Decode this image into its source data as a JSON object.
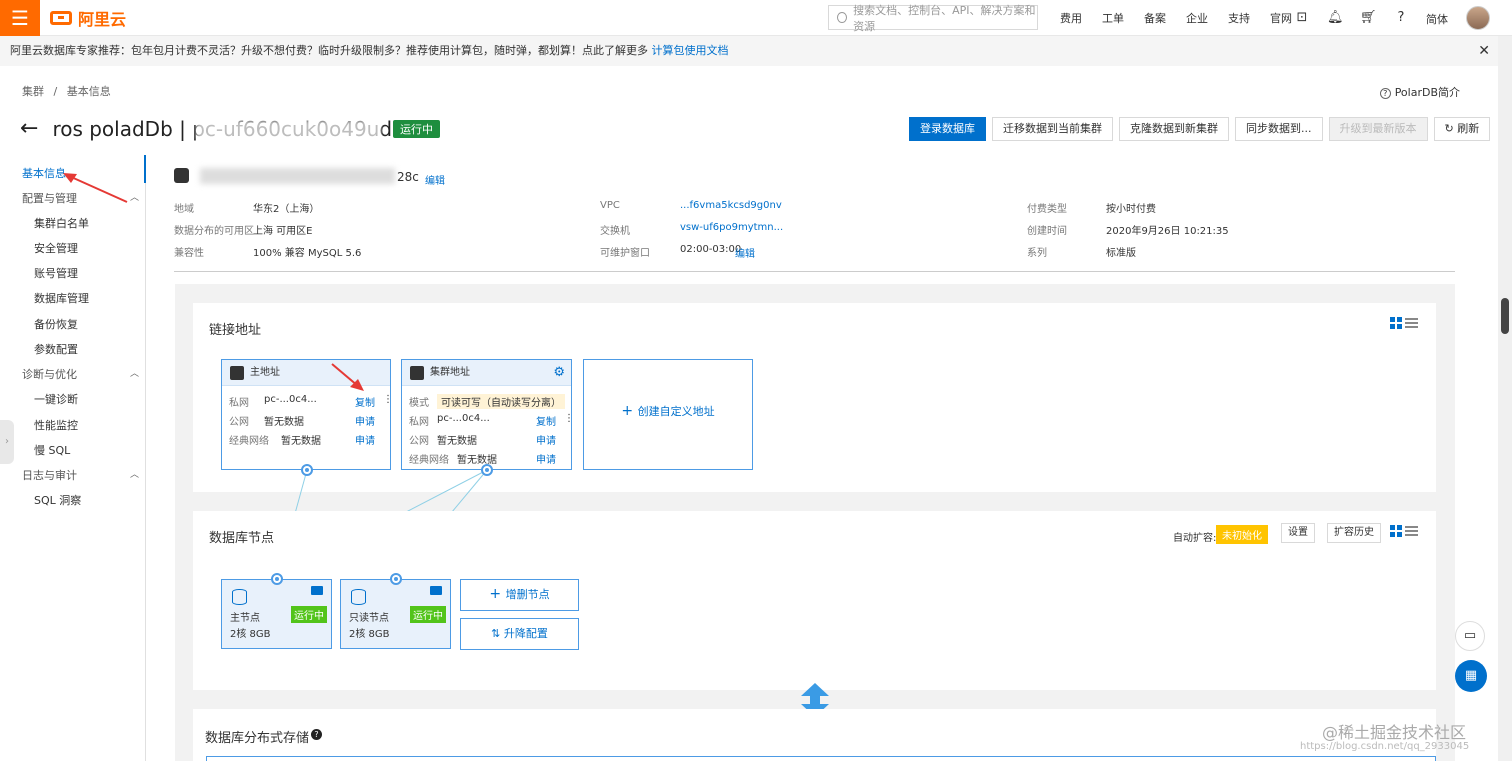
{
  "topbar": {
    "logo_text": "阿里云",
    "search_placeholder": "搜索文档、控制台、API、解决方案和资源",
    "links": [
      "费用",
      "工单",
      "备案",
      "企业",
      "支持",
      "官网"
    ],
    "lang": "简体"
  },
  "notice": {
    "text": "阿里云数据库专家推荐：包年包月计费不灵活？升级不想付费？临时升级限制多？推荐使用计算包，随时弹，都划算！点此了解更多",
    "link": "计算包使用文档"
  },
  "breadcrumb": {
    "root": "集群",
    "sep": "/",
    "current": "基本信息"
  },
  "polar_intro": "PolarDB简介",
  "page": {
    "title": "ros poladDb | pc-uf660cuk0o49ud28c",
    "status": "运行中"
  },
  "actions": [
    "登录数据库",
    "迁移数据到当前集群",
    "克隆数据到新集群",
    "同步数据到...",
    "升级到最新版本",
    "刷新"
  ],
  "sidebar": {
    "basic": "基本信息",
    "groups": [
      {
        "label": "配置与管理",
        "items": [
          "集群白名单",
          "安全管理",
          "账号管理",
          "数据库管理",
          "备份恢复",
          "参数配置"
        ]
      },
      {
        "label": "诊断与优化",
        "items": [
          "一键诊断",
          "性能监控",
          "慢 SQL"
        ]
      },
      {
        "label": "日志与审计",
        "items": [
          "SQL 洞察"
        ]
      }
    ]
  },
  "info": {
    "id_suffix": "28c",
    "edit": "编辑",
    "col1": [
      {
        "k": "地域",
        "v": "华东2（上海）"
      },
      {
        "k": "数据分布的可用区",
        "v": "上海 可用区E"
      },
      {
        "k": "兼容性",
        "v": "100% 兼容 MySQL 5.6"
      }
    ],
    "col2": [
      {
        "k": "VPC",
        "v": "...f6vma5kcsd9g0nv"
      },
      {
        "k": "交换机",
        "v": "vsw-uf6po9mytmn..."
      },
      {
        "k": "可维护窗口",
        "v": "02:00-03:00"
      }
    ],
    "col3": [
      {
        "k": "付费类型",
        "v": "按小时付费"
      },
      {
        "k": "创建时间",
        "v": "2020年9月26日 10:21:35"
      },
      {
        "k": "系列",
        "v": "标准版"
      }
    ]
  },
  "conn": {
    "title": "链接地址",
    "primary": {
      "head": "主地址",
      "rows": [
        {
          "k": "私网",
          "v": "pc-...0c4...",
          "a": "复制"
        },
        {
          "k": "公网",
          "v": "暂无数据",
          "a": "申请"
        },
        {
          "k": "经典网络",
          "v": "暂无数据",
          "a": "申请"
        }
      ]
    },
    "cluster": {
      "head": "集群地址",
      "mode_k": "模式",
      "mode_v": "可读可写（自动读写分离）",
      "rows": [
        {
          "k": "私网",
          "v": "pc-...0c4...",
          "a": "复制"
        },
        {
          "k": "公网",
          "v": "暂无数据",
          "a": "申请"
        },
        {
          "k": "经典网络",
          "v": "暂无数据",
          "a": "申请"
        }
      ]
    },
    "create": "创建自定义地址"
  },
  "nodes": {
    "title": "数据库节点",
    "auto_label": "自动扩容:",
    "auto_state": "未初始化",
    "settings": "设置",
    "history": "扩容历史",
    "items": [
      {
        "name": "主节点",
        "spec": "2核 8GB",
        "status": "运行中"
      },
      {
        "name": "只读节点",
        "spec": "2核 8GB",
        "status": "运行中"
      }
    ],
    "add": "增删节点",
    "scale": "升降配置"
  },
  "storage": {
    "title": "数据库分布式存储"
  },
  "watermark": {
    "text": "@稀土掘金技术社区",
    "sub": "https://blog.csdn.net/qq_2933045"
  }
}
